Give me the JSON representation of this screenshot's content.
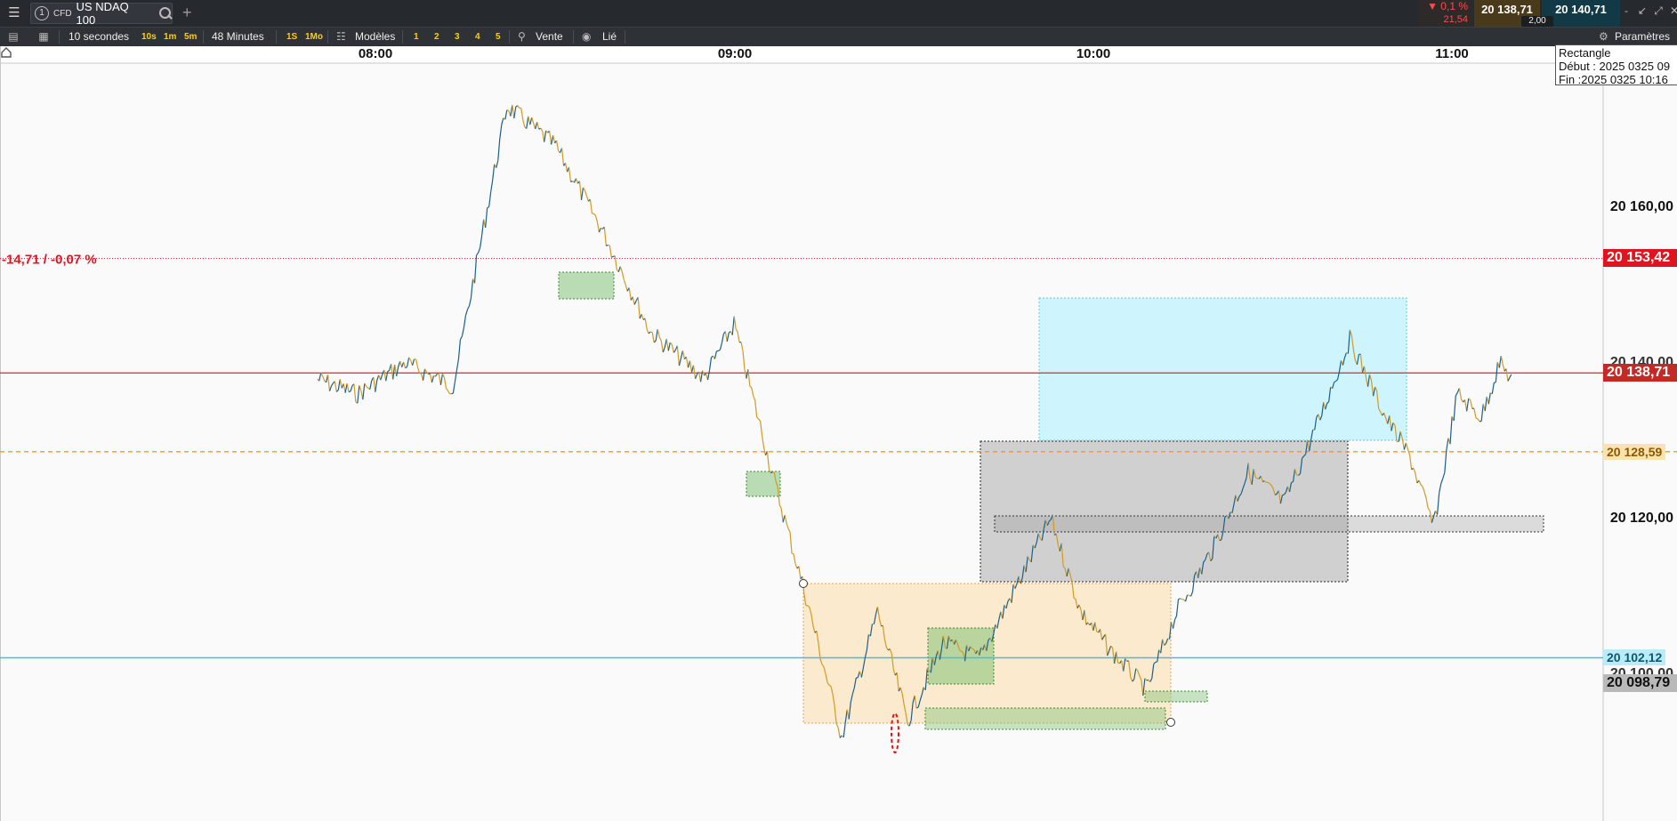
{
  "header": {
    "menu_icon": "hamburger-icon",
    "tab_number": "1",
    "instrument_type": "CFD",
    "instrument_name": "US NDAQ 100",
    "search_icon": "search-icon",
    "add_tab": "+",
    "change_pct": "▼ 0,1 %",
    "change_abs": "21,54",
    "bid_price": "20 138,71",
    "ask_price": "20 140,71",
    "spread": "2,00",
    "window_controls": [
      "-",
      "↙",
      "⤢",
      "✕"
    ]
  },
  "toolbar": {
    "interval": "10 secondes",
    "quick_intervals": [
      "10s",
      "1m",
      "5m"
    ],
    "duration": "48 Minutes",
    "quick_durations": [
      "1S",
      "1Mo"
    ],
    "templates_label": "Modèles",
    "template_slots": [
      "1",
      "2",
      "3",
      "4",
      "5"
    ],
    "sell_label": "Vente",
    "linked_label": "Lié",
    "settings_label": "Paramètres"
  },
  "colors": {
    "up": "#1b5f8c",
    "down": "#d29a23",
    "last_line": "#e53935",
    "prev_close_line": "#e0141e",
    "orange_level": "#f39c12",
    "cyan_level": "#3fc2e0"
  },
  "chart": {
    "time_labels": [
      "08:00",
      "09:00",
      "10:00",
      "11:00"
    ],
    "price_axis": [
      "20 160,00",
      "20 140,00",
      "20 120,00",
      "20 100,00"
    ],
    "change_label": "-14,71 / -0,07 %",
    "tags": {
      "prev_close": "20 153,42",
      "last": "20 138,71",
      "orange": "20 128,59",
      "cyan": "20 102,12",
      "grey": "20 098,79"
    },
    "tooltip": {
      "title": "Rectangle",
      "start": "Début : 2025 0325 09",
      "end": "Fin :2025 0325 10:16"
    },
    "alert_icon": "bell-icon"
  },
  "chart_data": {
    "type": "line",
    "title": "",
    "instrument": "US NDAQ 100",
    "x": [
      "07:50",
      "07:57",
      "08:05",
      "08:13",
      "08:22",
      "08:30",
      "08:38",
      "08:46",
      "08:55",
      "09:00",
      "09:07",
      "09:12",
      "09:18",
      "09:24",
      "09:29",
      "09:35",
      "09:41",
      "09:47",
      "09:53",
      "09:58",
      "10:03",
      "10:09",
      "10:14",
      "10:20",
      "10:26",
      "10:32",
      "10:38",
      "10:43",
      "10:49",
      "10:53",
      "10:57",
      "11:01",
      "11:05",
      "11:08",
      "11:10"
    ],
    "values": [
      20138,
      20136,
      20140,
      20137,
      20173,
      20168,
      20157,
      20144,
      20138,
      20145,
      20124,
      20110,
      20092,
      20108,
      20094,
      20104,
      20102,
      20111,
      20120,
      20108,
      20103,
      20098,
      20108,
      20116,
      20126,
      20122,
      20133,
      20143,
      20133,
      20128,
      20119,
      20136,
      20133,
      20140,
      20138
    ],
    "ylim": [
      20085,
      20180
    ],
    "ylabel": "",
    "grid": false
  }
}
